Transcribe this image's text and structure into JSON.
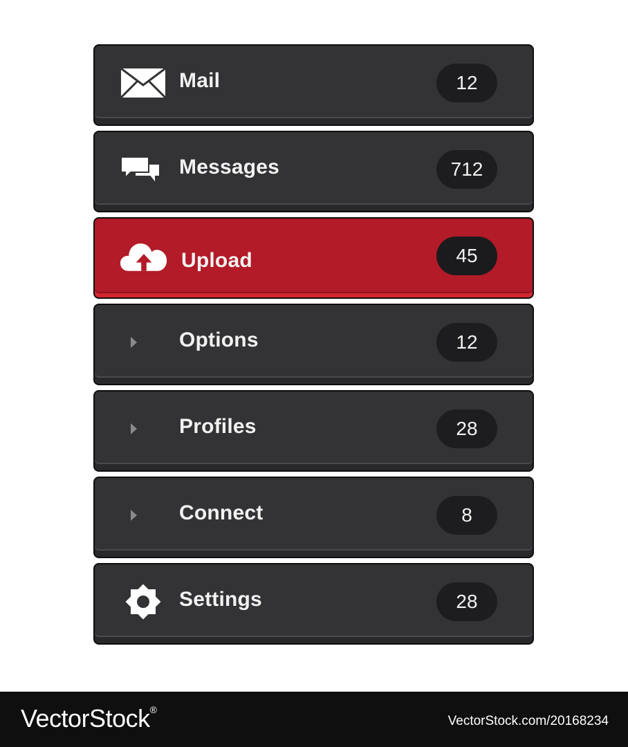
{
  "menu": {
    "items": [
      {
        "label": "Mail",
        "count": "12",
        "icon": "mail-icon",
        "active": false
      },
      {
        "label": "Messages",
        "count": "712",
        "icon": "chat-bubbles-icon",
        "active": false
      },
      {
        "label": "Upload",
        "count": "45",
        "icon": "cloud-upload-icon",
        "active": true
      },
      {
        "label": "Options",
        "count": "12",
        "icon": "caret-right-icon",
        "active": false
      },
      {
        "label": "Profiles",
        "count": "28",
        "icon": "caret-right-icon",
        "active": false
      },
      {
        "label": "Connect",
        "count": "8",
        "icon": "caret-right-icon",
        "active": false
      },
      {
        "label": "Settings",
        "count": "28",
        "icon": "gear-icon",
        "active": false
      }
    ]
  },
  "colors": {
    "item_background": "#333335",
    "active_background": "#b21b27",
    "badge_background": "#1d1d1f",
    "text": "#f2f2f2"
  },
  "watermark": {
    "logo": "VectorStock",
    "registered": "®",
    "url": "VectorStock.com/20168234"
  }
}
